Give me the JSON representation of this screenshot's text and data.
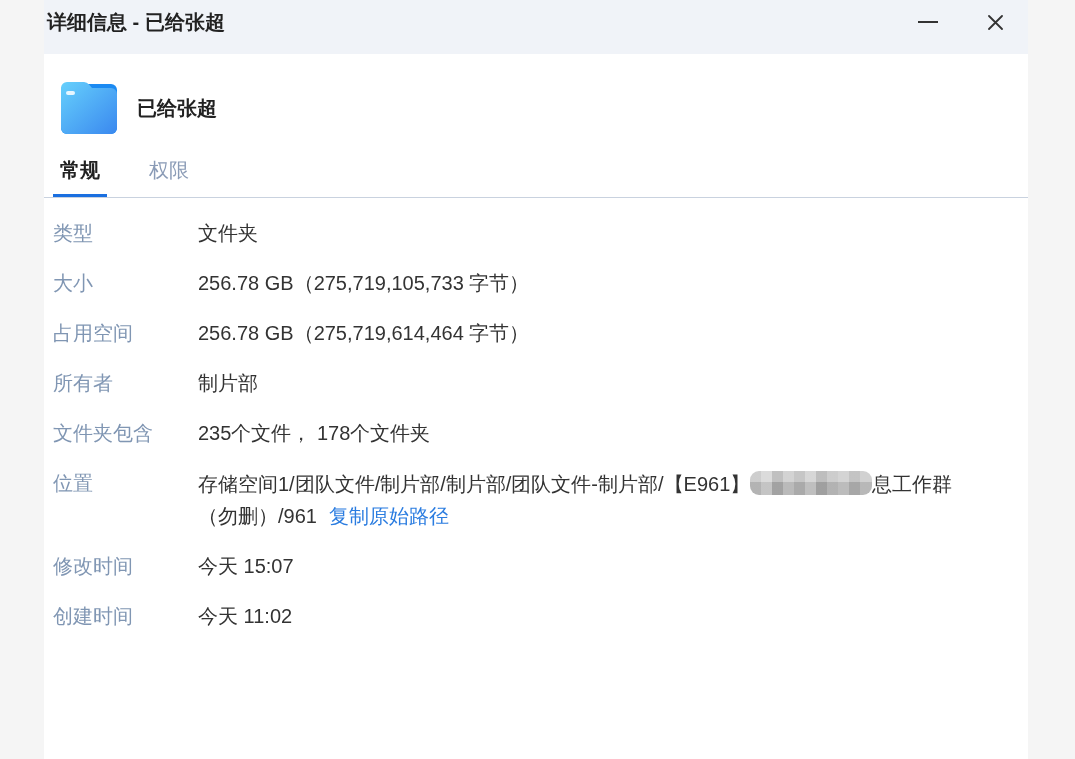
{
  "window": {
    "title": "详细信息 - 已给张超"
  },
  "header": {
    "name": "已给张超"
  },
  "tabs": [
    {
      "label": "常规",
      "selected": true
    },
    {
      "label": "权限",
      "selected": false
    }
  ],
  "properties": [
    {
      "kind": "text",
      "label": "类型",
      "value": "文件夹"
    },
    {
      "kind": "text",
      "label": "大小",
      "value": "256.78 GB（275,719,105,733 字节）"
    },
    {
      "kind": "text",
      "label": "占用空间",
      "value": "256.78 GB（275,719,614,464 字节）"
    },
    {
      "kind": "text",
      "label": "所有者",
      "value": "制片部"
    },
    {
      "kind": "text",
      "label": "文件夹包含",
      "value": "235个文件， 178个文件夹"
    },
    {
      "kind": "path",
      "label": "位置",
      "parts": [
        {
          "kind": "text",
          "text": "存储空间1/团队文件/制片部/制片部/团队文件-制片部/【E961】"
        },
        {
          "kind": "redacted"
        },
        {
          "kind": "text",
          "text": "息工作群"
        },
        {
          "kind": "text",
          "text": "（勿删）/961"
        },
        {
          "kind": "link",
          "text": "复制原始路径"
        }
      ]
    },
    {
      "kind": "text",
      "label": "修改时间",
      "value": "今天 15:07"
    },
    {
      "kind": "text",
      "label": "创建时间",
      "value": "今天 11:02"
    }
  ]
}
